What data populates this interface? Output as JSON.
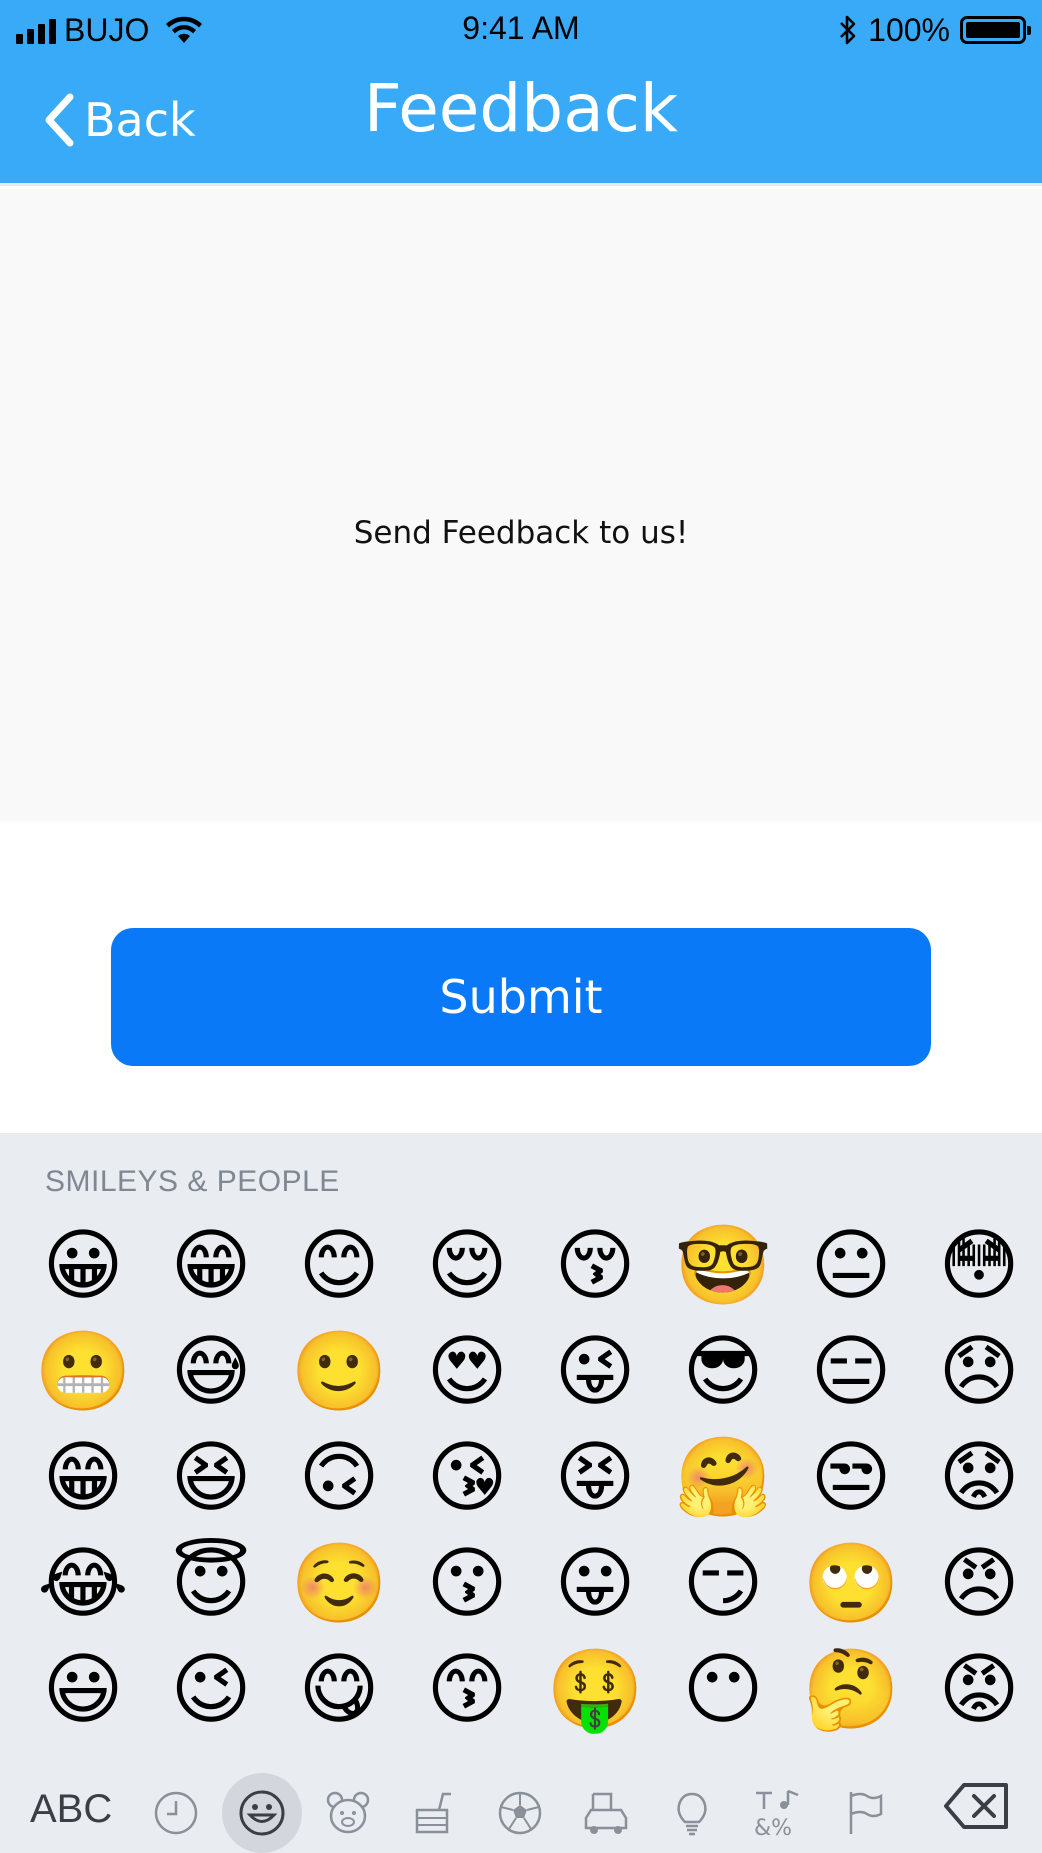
{
  "status_bar": {
    "carrier": "BUJO",
    "time": "9:41 AM",
    "battery_percent": "100%",
    "battery_level": 1.0
  },
  "nav": {
    "back_label": "Back",
    "title": "Feedback"
  },
  "feedback": {
    "prompt": "Send Feedback to us!"
  },
  "submit_label": "Submit",
  "keyboard": {
    "category_title": "SMILEYS & PEOPLE",
    "abc_label": "ABC",
    "emoji_rows": [
      [
        "😀",
        "😁",
        "😊",
        "😌",
        "😚",
        "🤓",
        "😐",
        "😳"
      ],
      [
        "😬",
        "😅",
        "🙂",
        "😍",
        "😜",
        "😎",
        "😑",
        "😞"
      ],
      [
        "😁",
        "😆",
        "🙃",
        "😘",
        "😝",
        "🤗",
        "😒",
        "😟"
      ],
      [
        "😂",
        "😇",
        "☺️",
        "😗",
        "😛",
        "😏",
        "🙄",
        "😠"
      ],
      [
        "😃",
        "😉",
        "😋",
        "😙",
        "🤑",
        "😶",
        "🤔",
        "😡"
      ]
    ],
    "category_icons": [
      "clock-icon",
      "smiley-icon",
      "bear-icon",
      "food-icon",
      "ball-icon",
      "car-icon",
      "bulb-icon",
      "symbols-icon",
      "flag-icon"
    ],
    "active_category": "smiley-icon"
  },
  "colors": {
    "nav_bg": "#38aaf8",
    "submit_bg": "#0a79f8",
    "keyboard_bg": "#e9ecf1"
  }
}
